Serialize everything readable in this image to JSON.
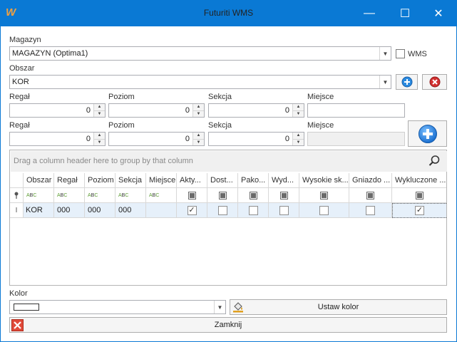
{
  "window": {
    "title": "Futuriti WMS",
    "app_icon": "W",
    "minimize": "—",
    "maximize": "☐",
    "close": "✕"
  },
  "magazyn": {
    "label": "Magazyn",
    "value": "MAGAZYN (Optima1)",
    "wms_label": "WMS",
    "wms_checked": false
  },
  "obszar": {
    "label": "Obszar",
    "value": "KOR"
  },
  "row1": {
    "regal": {
      "label": "Regał",
      "value": "0"
    },
    "poziom": {
      "label": "Poziom",
      "value": "0"
    },
    "sekcja": {
      "label": "Sekcja",
      "value": "0"
    },
    "miejsce": {
      "label": "Miejsce",
      "value": ""
    }
  },
  "row2": {
    "regal": {
      "label": "Regał",
      "value": "0"
    },
    "poziom": {
      "label": "Poziom",
      "value": "0"
    },
    "sekcja": {
      "label": "Sekcja",
      "value": "0"
    },
    "miejsce": {
      "label": "Miejsce",
      "value": ""
    }
  },
  "grid": {
    "group_panel_text": "Drag a column header here to group by that column",
    "columns": [
      "Obszar",
      "Regał",
      "Poziom",
      "Sekcja",
      "Miejsce",
      "Akty...",
      "Dost...",
      "Pako...",
      "Wyd...",
      "Wysokie sk...",
      "Gniazdo ...",
      "Wykluczone ..."
    ],
    "filter_text_icon": "ABC",
    "rows": [
      {
        "obszar": "KOR",
        "regal": "000",
        "poziom": "000",
        "sekcja": "000",
        "miejsce": "",
        "checks": [
          true,
          false,
          false,
          false,
          false,
          false,
          true
        ]
      }
    ]
  },
  "kolor": {
    "label": "Kolor",
    "button": "Ustaw kolor"
  },
  "close_button": "Zamknij",
  "colors": {
    "titlebar": "#0a79d4",
    "selected_row": "#e6f0fa",
    "add_blue": "#2a8ae0",
    "delete_red": "#d23030"
  }
}
